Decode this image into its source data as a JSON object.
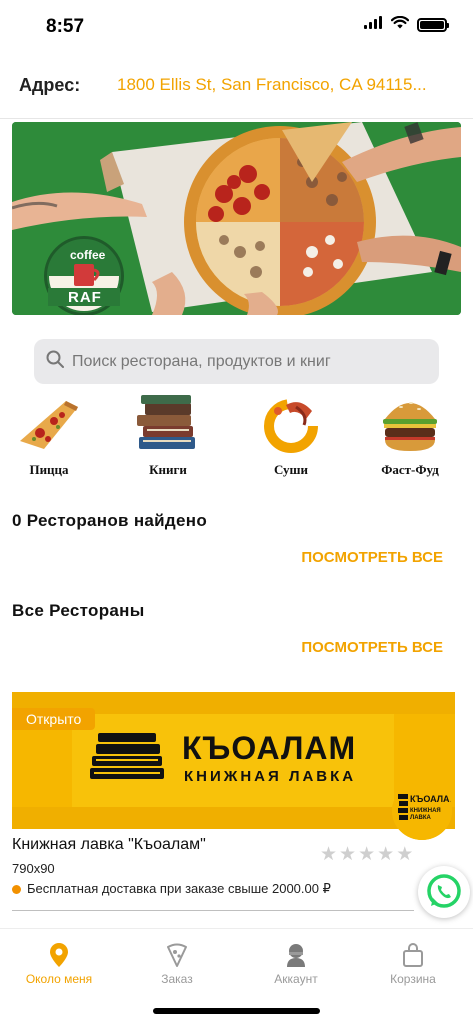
{
  "status_bar": {
    "time": "8:57"
  },
  "address": {
    "label": "Адрес:",
    "value": "1800 Ellis St, San Francisco, CA 94115..."
  },
  "banner": {
    "logo_top": "coffee",
    "logo_bottom": "RAF"
  },
  "search": {
    "placeholder": "Поиск ресторана, продуктов и книг"
  },
  "categories": [
    {
      "label": "Пицца",
      "icon": "pizza-slice-icon"
    },
    {
      "label": "Книги",
      "icon": "books-icon"
    },
    {
      "label": "Суши",
      "icon": "sushi-icon"
    },
    {
      "label": "Фаст-Фуд",
      "icon": "burger-icon"
    }
  ],
  "found_section": {
    "title": "0 Ресторанов найдено",
    "see_all": "ПОСМОТРЕТЬ ВСЕ"
  },
  "all_section": {
    "title": "Все Рестораны",
    "see_all": "ПОСМОТРЕТЬ ВСЕ"
  },
  "restaurant": {
    "status": "Открыто",
    "name": "Книжная лавка \"Къоалам\"",
    "subtitle": "790x90",
    "rating": 0,
    "rating_max": 5,
    "delivery": "Бесплатная доставка при заказе свыше 2000.00 ₽",
    "banner_title": "КЪОАЛАМ",
    "banner_subtitle": "КНИЖНАЯ ЛАВКА",
    "logo_title": "КЪОАЛАМ",
    "logo_subtitle": "КНИЖНАЯ ЛАВКА"
  },
  "tabs": [
    {
      "label": "Около меня",
      "icon": "location-pin-icon",
      "active": true
    },
    {
      "label": "Заказ",
      "icon": "pizza-icon",
      "active": false
    },
    {
      "label": "Аккаунт",
      "icon": "account-icon",
      "active": false
    },
    {
      "label": "Корзина",
      "icon": "shopping-bag-icon",
      "active": false
    }
  ],
  "colors": {
    "accent": "#f2a300",
    "banner_green": "#2e8b3a",
    "card_yellow": "#f6b700"
  }
}
